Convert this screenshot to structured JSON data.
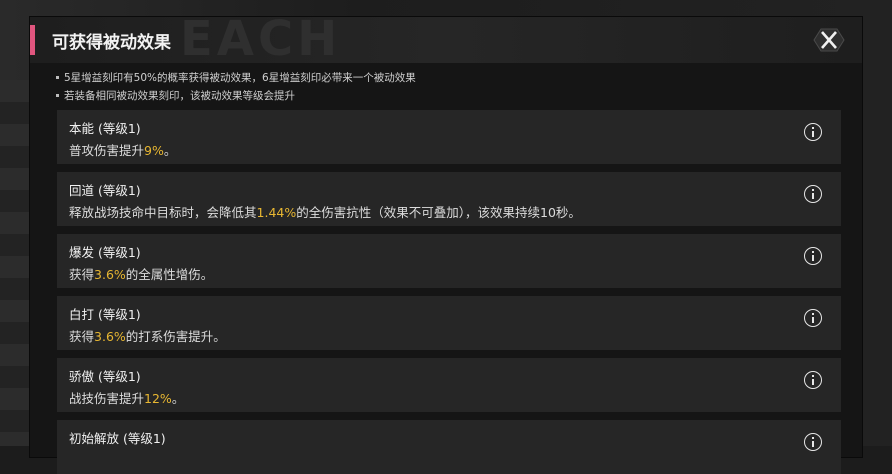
{
  "dialog": {
    "title": "可获得被动效果",
    "watermark": "EACH"
  },
  "notes": [
    "5星增益刻印有50%的概率获得被动效果，6星增益刻印必带来一个被动效果",
    "若装备相同被动效果刻印，该被动效果等级会提升"
  ],
  "effects": [
    {
      "name": "本能 (等级1)",
      "desc_before": "普攻伤害提升",
      "highlight": "9%",
      "desc_after": "。"
    },
    {
      "name": "回道 (等级1)",
      "desc_before": "释放战场技命中目标时，会降低其",
      "highlight": "1.44%",
      "desc_after": "的全伤害抗性（效果不可叠加），该效果持续10秒。"
    },
    {
      "name": "爆发 (等级1)",
      "desc_before": "获得",
      "highlight": "3.6%",
      "desc_after": "的全属性增伤。"
    },
    {
      "name": "白打 (等级1)",
      "desc_before": "获得",
      "highlight": "3.6%",
      "desc_after": "的打系伤害提升。"
    },
    {
      "name": "骄傲 (等级1)",
      "desc_before": "战技伤害提升",
      "highlight": "12%",
      "desc_after": "。"
    },
    {
      "name": "初始解放 (等级1)",
      "desc_before": "",
      "highlight": "",
      "desc_after": ""
    }
  ],
  "colors": {
    "accent": "#e0557e",
    "highlight": "#e8b732"
  }
}
